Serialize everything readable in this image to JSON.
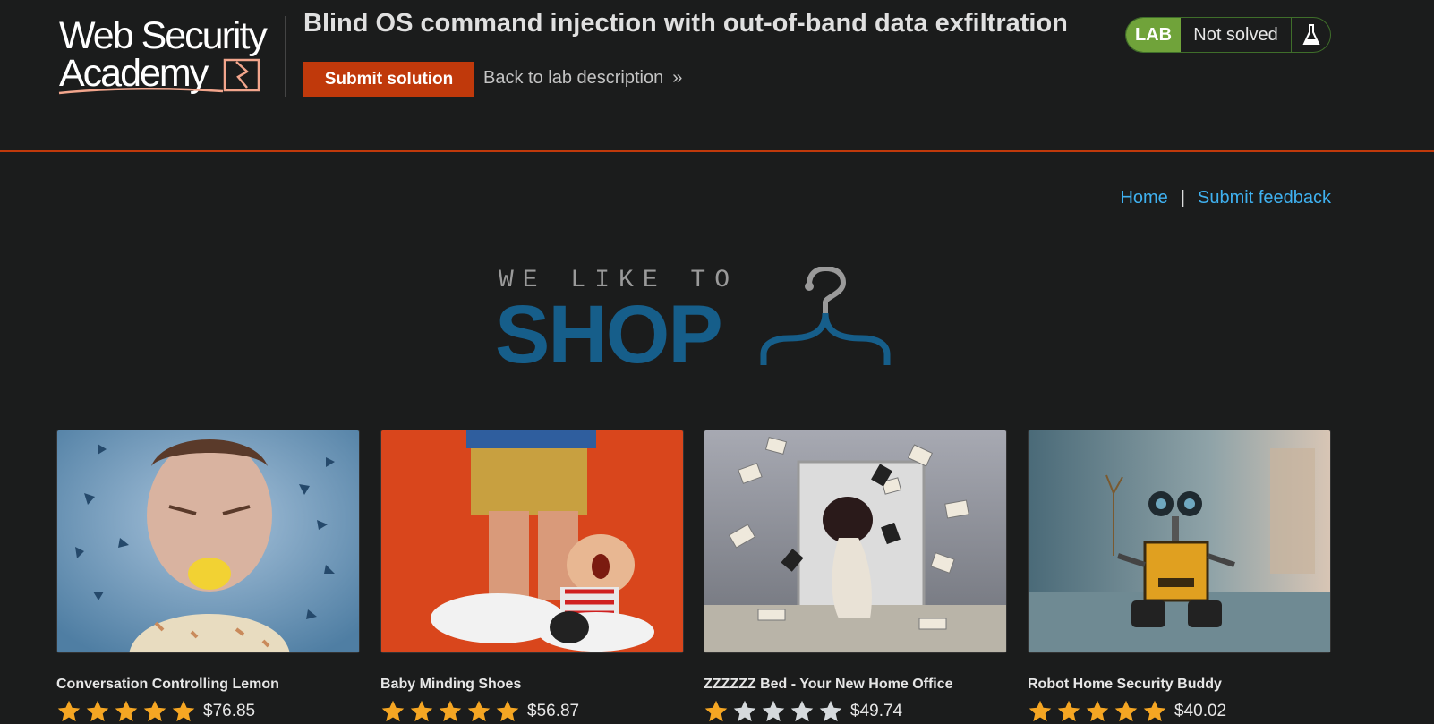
{
  "header": {
    "logo_text_line1": "Web Security",
    "logo_text_line2": "Academy",
    "lab_title": "Blind OS command injection with out-of-band data exfiltration",
    "submit_label": "Submit solution",
    "back_label": "Back to lab description",
    "back_chevron": "»",
    "lab_tag": "LAB",
    "lab_status": "Not solved",
    "colors": {
      "accent": "#c0390b",
      "lab_green": "#70a33a"
    }
  },
  "nav": {
    "home": "Home",
    "separator": "|",
    "feedback": "Submit feedback"
  },
  "hero": {
    "tagline": "WE LIKE TO",
    "title": "SHOP",
    "title_color": "#165e8a"
  },
  "products": [
    {
      "name": "Conversation Controlling Lemon",
      "stars": 5,
      "price": "$76.85",
      "image": "man-biting-lemon"
    },
    {
      "name": "Baby Minding Shoes",
      "stars": 5,
      "price": "$56.87",
      "image": "figurine-shoes"
    },
    {
      "name": "ZZZZZZ Bed - Your New Home Office",
      "stars": 1,
      "price": "$49.74",
      "image": "woman-flying-books"
    },
    {
      "name": "Robot Home Security Buddy",
      "stars": 5,
      "price": "$40.02",
      "image": "wall-e-robot"
    }
  ]
}
